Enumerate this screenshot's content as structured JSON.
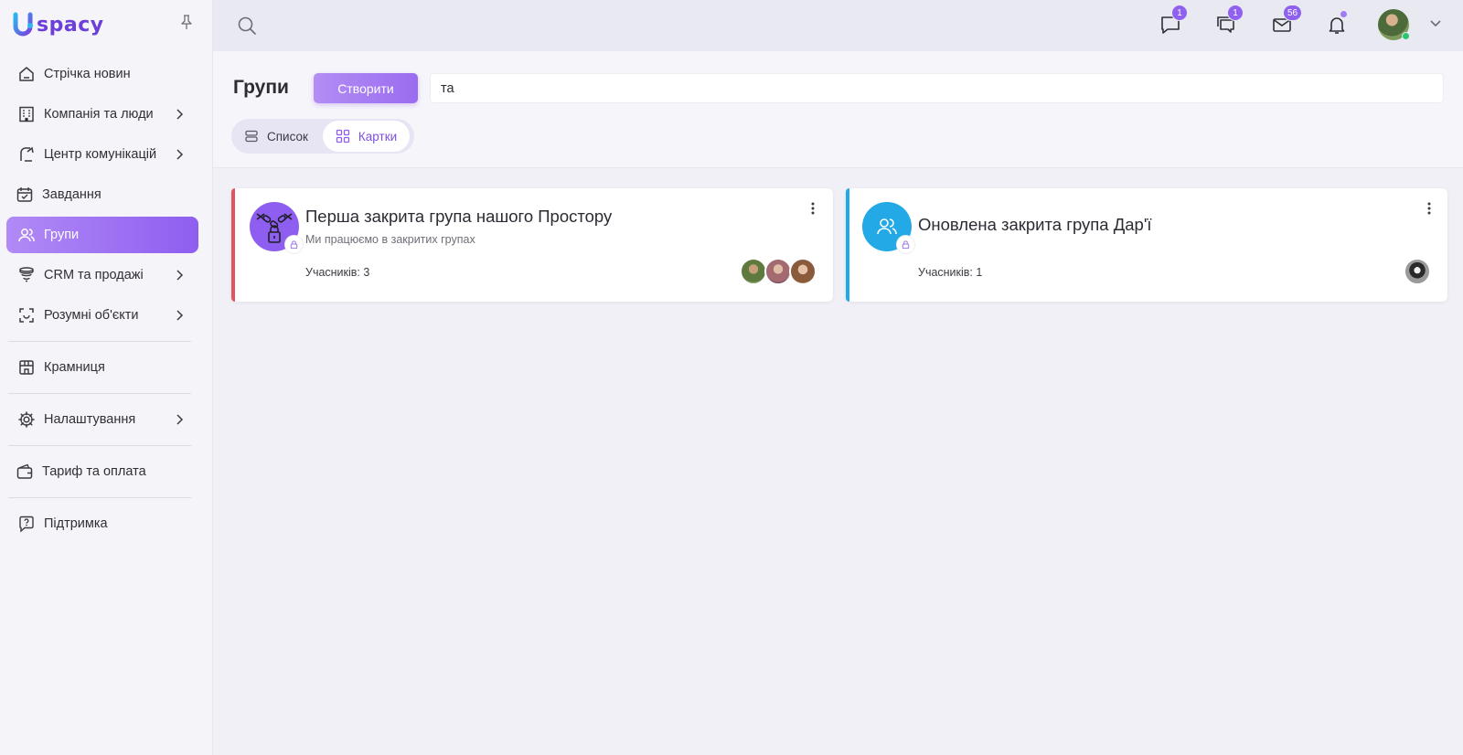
{
  "app": {
    "logo_text": "spacy"
  },
  "sidebar": {
    "items": [
      {
        "label": "Стрічка новин",
        "icon": "home-icon"
      },
      {
        "label": "Компанія та люди",
        "icon": "building-icon"
      },
      {
        "label": "Центр комунікацій",
        "icon": "communication-icon"
      },
      {
        "label": "Завдання",
        "icon": "calendar-check-icon"
      },
      {
        "label": "Групи",
        "icon": "users-icon"
      },
      {
        "label": "CRM та продажі",
        "icon": "funnel-icon"
      },
      {
        "label": "Розумні об'єкти",
        "icon": "scan-icon"
      },
      {
        "label": "Крамниця",
        "icon": "store-icon"
      },
      {
        "label": "Налаштування",
        "icon": "gear-icon"
      },
      {
        "label": "Тариф та оплата",
        "icon": "wallet-icon"
      },
      {
        "label": "Підтримка",
        "icon": "help-icon"
      }
    ],
    "active_index": 4
  },
  "topbar": {
    "chat_badge": "1",
    "comments_badge": "1",
    "mail_badge": "56"
  },
  "page": {
    "title": "Групи",
    "create_label": "Створити",
    "search_value": "та",
    "view_list_label": "Список",
    "view_cards_label": "Картки"
  },
  "groups": [
    {
      "title": "Перша закрита група нашого Простору",
      "description": "Ми працюємо в закритих групах",
      "members_label": "Учасників: 3",
      "accent_color": "#e0565e",
      "avatar_color": "#8e5ef0"
    },
    {
      "title": "Оновлена закрита група Дар'ї",
      "description": "",
      "members_label": "Учасників: 1",
      "accent_color": "#23a9e6",
      "avatar_color": "#23a9e6"
    }
  ]
}
